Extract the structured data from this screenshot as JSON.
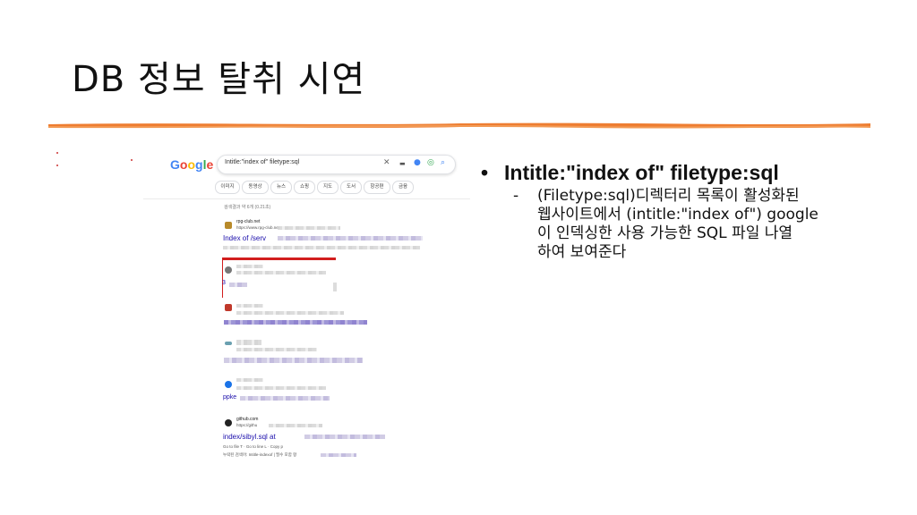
{
  "slide": {
    "title": "DB 정보 탈취 시연",
    "accent_color": "#ee7d31",
    "bullet": "Intitle:\"index of\" filetype:sql",
    "sub_dash": "-",
    "sub_text": "(Filetype:sql)디렉터리 목록이 활성화된\n웹사이트에서 (intitle:\"index of\") google\n이 인덱싱한 사용 가능한 SQL 파일 나열\n하여 보여준다"
  },
  "screenshot": {
    "logo": "Google",
    "query": "Intitle:\"index of\" filetype:sql",
    "icons": [
      "clear-icon",
      "keyboard-icon",
      "mic-icon",
      "lens-icon",
      "search-icon"
    ],
    "chips": [
      "이미지",
      "동영상",
      "뉴스",
      "쇼핑",
      "지도",
      "도서",
      "항공편",
      "금융"
    ],
    "meta": "검색결과 약 6개 (0.21초)",
    "results": [
      {
        "site": "rpg-club.net",
        "url": "https://www.rpg-club.net",
        "title": "Index of /serv"
      },
      {
        "title": "3"
      },
      {
        "title": ""
      },
      {
        "title": ""
      },
      {
        "title": "ppke"
      },
      {
        "site": "github.com",
        "url": "https://githu",
        "title": "index/sibyl.sql at",
        "snippet1": "Go to file T · Go to line L · Copy p",
        "snippet2": "누락된 검색어: Intitle-indexof | 필수 포함 항"
      }
    ]
  }
}
